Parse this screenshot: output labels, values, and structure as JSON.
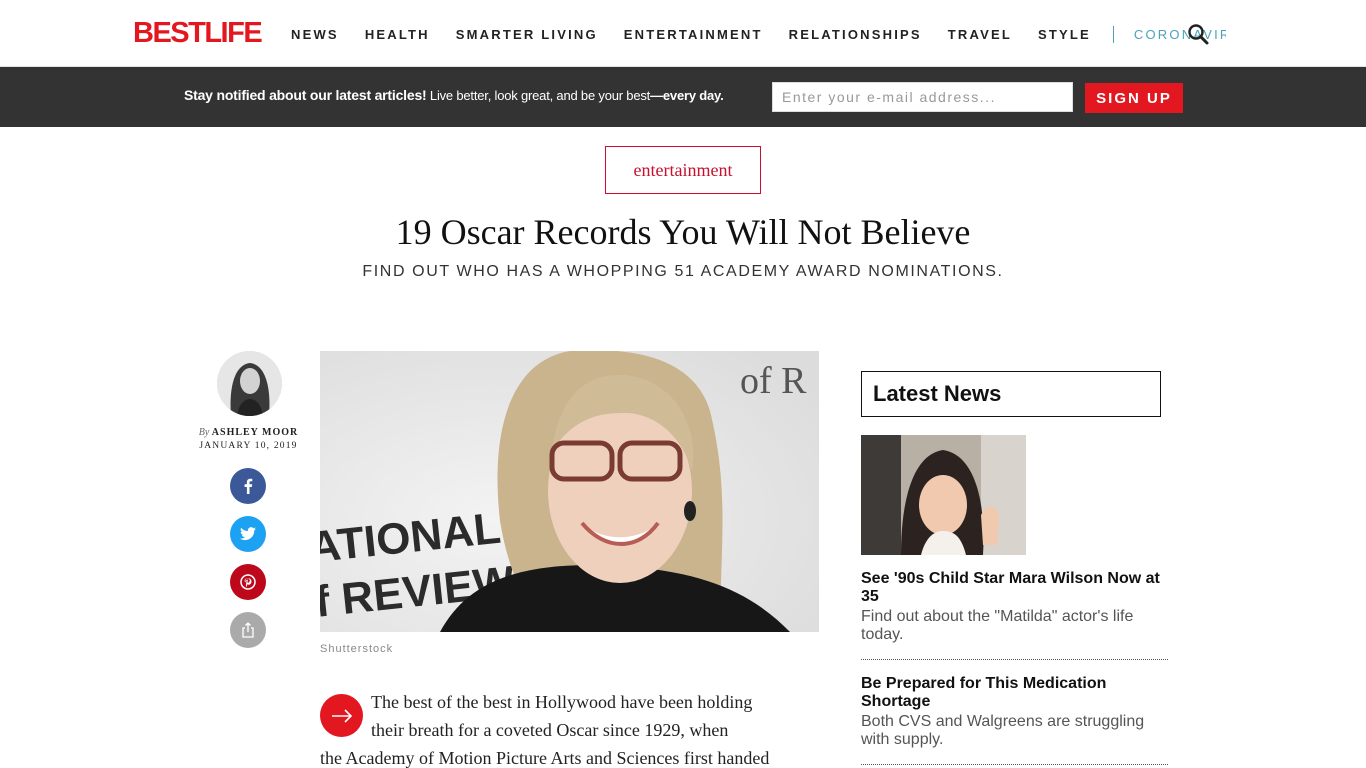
{
  "logo": "BESTLIFE",
  "nav": {
    "items": [
      "NEWS",
      "HEALTH",
      "SMARTER LIVING",
      "ENTERTAINMENT",
      "RELATIONSHIPS",
      "TRAVEL",
      "STYLE"
    ],
    "highlight": "CORONAVIRUS"
  },
  "newsletter": {
    "lead": "Stay notified about our latest articles!",
    "text": " Live better, look great, and be your best",
    "tail": "—every day.",
    "email_placeholder": "Enter your e-mail address...",
    "signup_label": "SIGN UP"
  },
  "article": {
    "category": "entertainment",
    "title": "19 Oscar Records You Will Not Believe",
    "subtitle": "FIND OUT WHO HAS A WHOPPING 51 ACADEMY AWARD NOMINATIONS.",
    "by": "By",
    "author": "ASHLEY MOOR",
    "date": "JANUARY 10, 2019",
    "image_credit": "Shutterstock",
    "body_line1": "The best of the best in Hollywood have been holding",
    "body_line2": "their breath for a coveted Oscar since 1929, when",
    "body_line3": "the Academy of Motion Picture Arts and Sciences first handed"
  },
  "sidebar": {
    "heading": "Latest News",
    "items": [
      {
        "headline": "See '90s Child Star Mara Wilson Now at 35",
        "desc": "Find out about the \"Matilda\" actor's life today."
      },
      {
        "headline": "Be Prepared for This Medication Shortage",
        "desc": "Both CVS and Walgreens are struggling with supply."
      }
    ]
  },
  "colors": {
    "brand_red": "#e2171f",
    "category_red": "#c8102e",
    "coronavirus_teal": "#4aa3b8",
    "newsbar_bg": "#333333"
  }
}
